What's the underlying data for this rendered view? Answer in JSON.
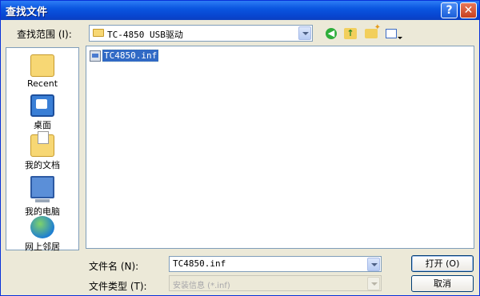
{
  "window": {
    "title": "查找文件",
    "help_glyph": "?",
    "close_glyph": "✕"
  },
  "toolbar": {
    "look_in_label": "查找范围 (I):",
    "look_in_value": "TC-4850 USB驱动",
    "icons": [
      "back-icon",
      "up-folder-icon",
      "new-folder-icon",
      "views-menu-icon"
    ]
  },
  "places": [
    {
      "label": "Recent",
      "icon": "recent-folder-icon"
    },
    {
      "label": "桌面",
      "icon": "desktop-icon"
    },
    {
      "label": "我的文档",
      "icon": "my-documents-icon"
    },
    {
      "label": "我的电脑",
      "icon": "my-computer-icon"
    },
    {
      "label": "网上邻居",
      "icon": "network-places-icon"
    }
  ],
  "files": [
    {
      "name": "TC4850.inf",
      "icon": "setup-info-file-icon",
      "selected": true
    }
  ],
  "form": {
    "filename_label": "文件名 (N):",
    "filename_value": "TC4850.inf",
    "filetype_label": "文件类型 (T):",
    "filetype_value": "安装信息 (*.inf)"
  },
  "buttons": {
    "open": "打开 (O)",
    "cancel": "取消"
  },
  "colors": {
    "titlebar": "#0a56e0",
    "selection": "#316ac5",
    "dialog_bg": "#ece9d8"
  }
}
